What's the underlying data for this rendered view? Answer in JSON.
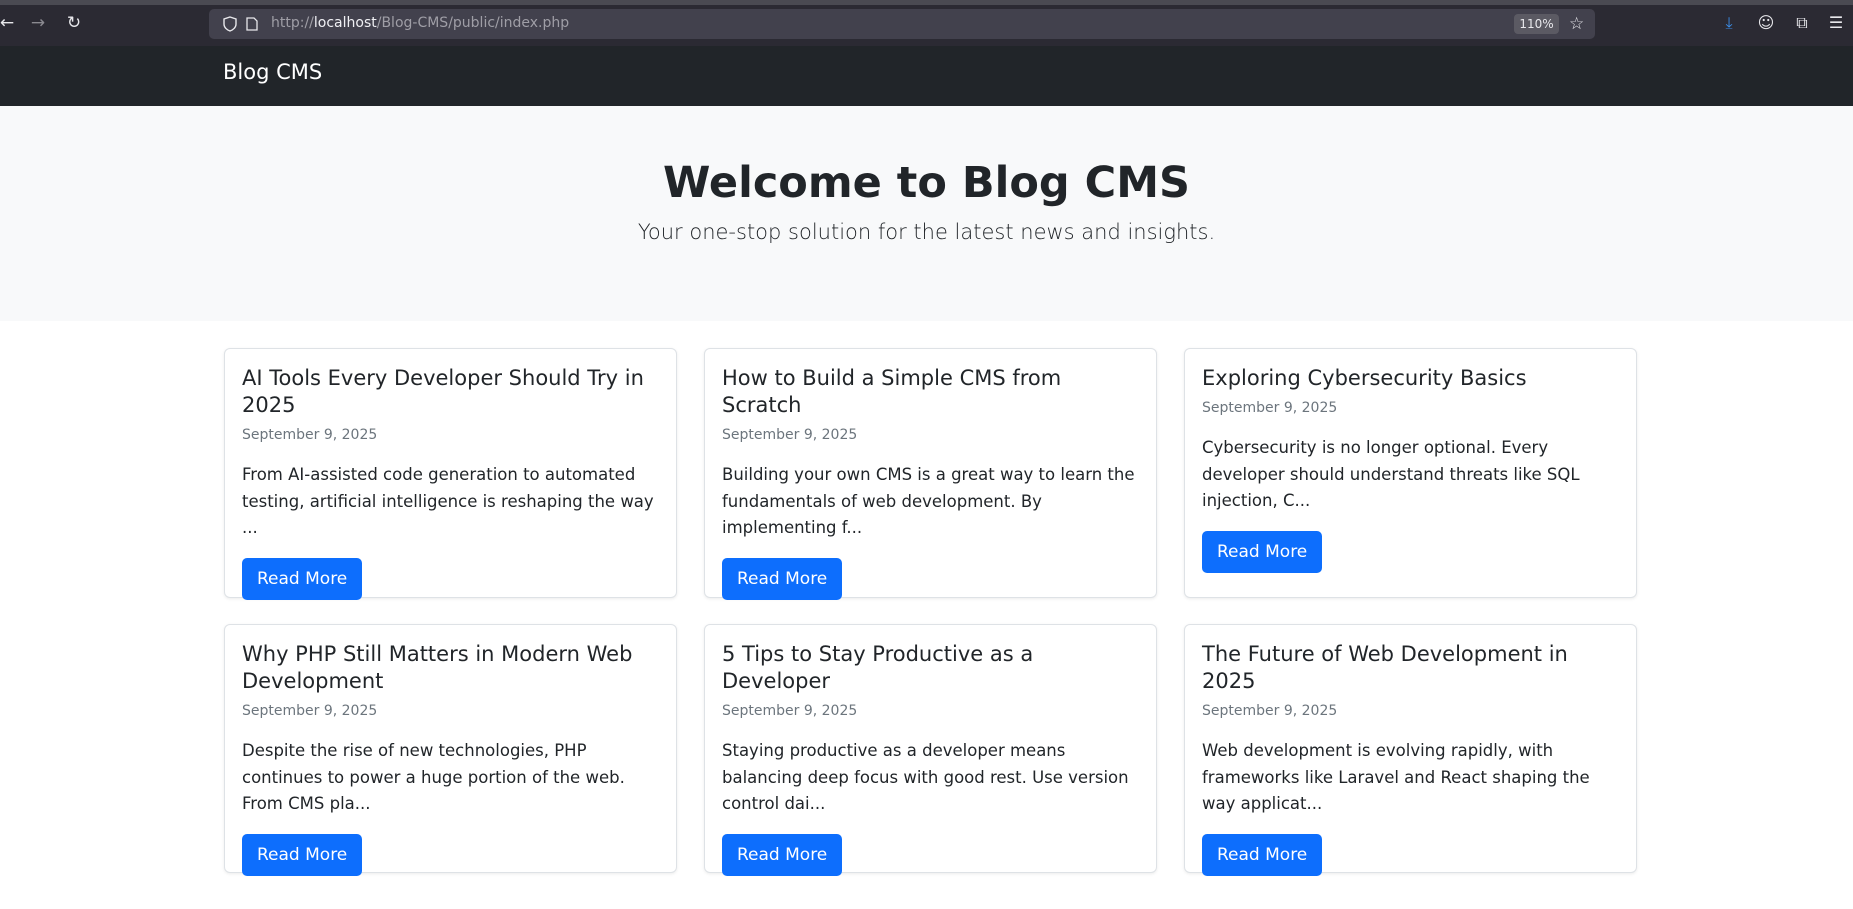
{
  "browser": {
    "url_prefix": "http://",
    "url_host": "localhost",
    "url_path": "/Blog-CMS/public/index.php",
    "zoom": "110%"
  },
  "navbar": {
    "brand": "Blog CMS"
  },
  "hero": {
    "title": "Welcome to Blog CMS",
    "subtitle": "Your one-stop solution for the latest news and insights."
  },
  "posts": [
    {
      "title": "AI Tools Every Developer Should Try in 2025",
      "date": "September 9, 2025",
      "excerpt": "From AI-assisted code generation to automated testing, artificial intelligence is reshaping the way ...",
      "button": "Read More"
    },
    {
      "title": "How to Build a Simple CMS from Scratch",
      "date": "September 9, 2025",
      "excerpt": "Building your own CMS is a great way to learn the fundamentals of web development. By implementing f...",
      "button": "Read More"
    },
    {
      "title": "Exploring Cybersecurity Basics",
      "date": "September 9, 2025",
      "excerpt": "Cybersecurity is no longer optional. Every developer should understand threats like SQL injection, C...",
      "button": "Read More"
    },
    {
      "title": "Why PHP Still Matters in Modern Web Development",
      "date": "September 9, 2025",
      "excerpt": "Despite the rise of new technologies, PHP continues to power a huge portion of the web. From CMS pla...",
      "button": "Read More"
    },
    {
      "title": "5 Tips to Stay Productive as a Developer",
      "date": "September 9, 2025",
      "excerpt": "Staying productive as a developer means balancing deep focus with good rest. Use version control dai...",
      "button": "Read More"
    },
    {
      "title": "The Future of Web Development in 2025",
      "date": "September 9, 2025",
      "excerpt": "Web development is evolving rapidly, with frameworks like Laravel and React shaping the way applicat...",
      "button": "Read More"
    }
  ],
  "colors": {
    "navbar_bg": "#212529",
    "hero_bg": "#f8f9fa",
    "primary_button": "#0d6efd",
    "muted_text": "#6c757d"
  }
}
